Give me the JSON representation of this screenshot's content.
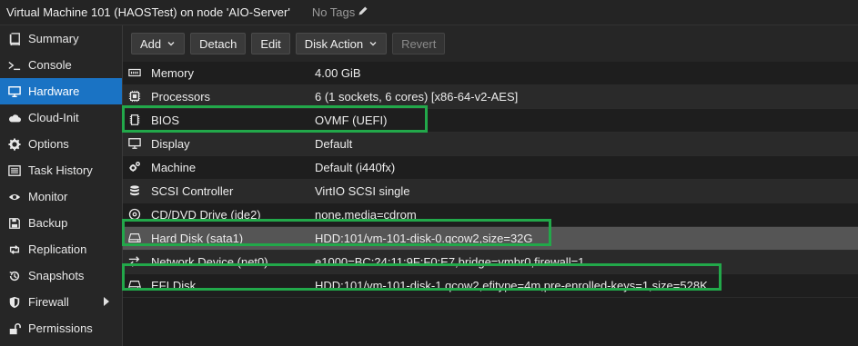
{
  "header": {
    "title": "Virtual Machine 101 (HAOSTest) on node 'AIO-Server'",
    "tags_label": "No Tags"
  },
  "sidebar": {
    "items": [
      {
        "label": "Summary",
        "icon": "book-icon"
      },
      {
        "label": "Console",
        "icon": "terminal-icon"
      },
      {
        "label": "Hardware",
        "icon": "monitor-icon",
        "active": true
      },
      {
        "label": "Cloud-Init",
        "icon": "cloud-icon"
      },
      {
        "label": "Options",
        "icon": "gear-icon"
      },
      {
        "label": "Task History",
        "icon": "list-icon"
      },
      {
        "label": "Monitor",
        "icon": "eye-icon"
      },
      {
        "label": "Backup",
        "icon": "floppy-icon"
      },
      {
        "label": "Replication",
        "icon": "retweet-icon"
      },
      {
        "label": "Snapshots",
        "icon": "history-icon"
      },
      {
        "label": "Firewall",
        "icon": "shield-icon",
        "has_submenu": true
      },
      {
        "label": "Permissions",
        "icon": "unlock-icon"
      }
    ]
  },
  "toolbar": {
    "add_label": "Add",
    "detach_label": "Detach",
    "edit_label": "Edit",
    "disk_action_label": "Disk Action",
    "revert_label": "Revert"
  },
  "hardware": {
    "rows": [
      {
        "label": "Memory",
        "value": "4.00 GiB",
        "icon": "memory-icon"
      },
      {
        "label": "Processors",
        "value": "6 (1 sockets, 6 cores) [x86-64-v2-AES]",
        "icon": "cpu-icon"
      },
      {
        "label": "BIOS",
        "value": "OVMF (UEFI)",
        "icon": "chip-icon"
      },
      {
        "label": "Display",
        "value": "Default",
        "icon": "desktop-icon"
      },
      {
        "label": "Machine",
        "value": "Default (i440fx)",
        "icon": "cogs-icon"
      },
      {
        "label": "SCSI Controller",
        "value": "VirtIO SCSI single",
        "icon": "database-icon"
      },
      {
        "label": "CD/DVD Drive (ide2)",
        "value": "none,media=cdrom",
        "icon": "cdrom-icon"
      },
      {
        "label": "Hard Disk (sata1)",
        "value": "HDD:101/vm-101-disk-0.qcow2,size=32G",
        "icon": "hdd-icon"
      },
      {
        "label": "Network Device (net0)",
        "value": "e1000=BC:24:11:9F:F0:E7,bridge=vmbr0,firewall=1",
        "icon": "exchange-icon"
      },
      {
        "label": "EFI Disk",
        "value": "HDD:101/vm-101-disk-1.qcow2,efitype=4m,pre-enrolled-keys=1,size=528K",
        "icon": "hdd-icon"
      }
    ],
    "selected_row": "Hard Disk (sata1)",
    "highlight_color": "#22a84a"
  }
}
